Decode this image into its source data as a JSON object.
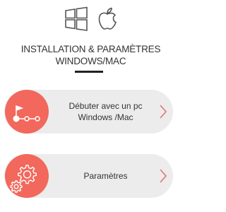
{
  "header": {
    "icons": [
      "windows-icon",
      "apple-icon"
    ],
    "title_line1": "INSTALLATION & PARAMÈTRES",
    "title_line2": "WINDOWS/MAC"
  },
  "cards": [
    {
      "label_line1": "Débuter avec un pc",
      "label_line2": "Windows /Mac",
      "icon": "start-path-icon"
    },
    {
      "label_line1": "Paramètres",
      "label_line2": "",
      "icon": "gears-icon"
    }
  ],
  "colors": {
    "accent": "#f2685c",
    "card_bg": "#ececec",
    "icon_stroke": "#555555",
    "chevron": "#e8736a"
  }
}
